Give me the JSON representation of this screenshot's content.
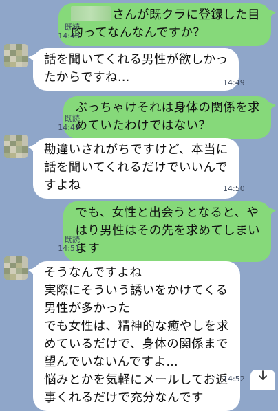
{
  "messages": [
    {
      "side": "out",
      "text": "さんが既クラに登録した目\n的ってなんなんですか？",
      "read": "既読",
      "time": "14:48"
    },
    {
      "side": "in",
      "text": "話を聞いてくれる男性が欲しかっ\nたからですね…",
      "time": "14:49"
    },
    {
      "side": "out",
      "text": "ぶっちゃけそれは身体の関係を求\nめていたわけではない？",
      "read": "既読",
      "time": "14:49"
    },
    {
      "side": "in",
      "text": "勘違いされがちですけど、本当に\n話を聞いてくれるだけでいいんで\nすよね",
      "time": "14:50"
    },
    {
      "side": "out",
      "text": "でも、女性と出会うとなると、や\nはり男性はその先を求めてしまい\nます",
      "read": "既読",
      "time": "14:51"
    },
    {
      "side": "in",
      "text": "そうなんですよね\n実際にそういう誘いをかけてくる\n男性が多かった\nでも女性は、精神的な癒やしを求\nめているだけで、身体の関係まで\n望んでいないんですよ…\n悩みとかを気軽にメールしてお返\n事くれるだけで充分なんです",
      "time": "14:52"
    }
  ],
  "icons": {
    "scroll_down": "arrow-down-icon"
  },
  "colors": {
    "background": "#8fa6c9",
    "outgoing_bubble": "#86d97a",
    "incoming_bubble": "#ffffff"
  }
}
